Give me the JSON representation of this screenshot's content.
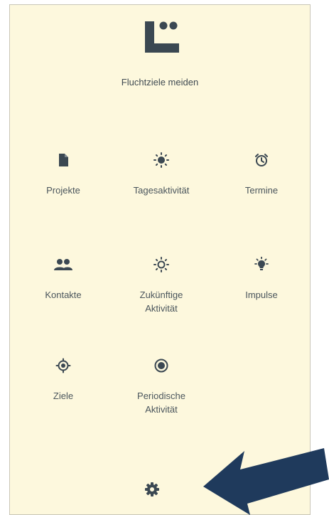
{
  "app": {
    "title": "Fluchtziele meiden"
  },
  "menu": {
    "items": [
      {
        "label": "Projekte",
        "icon": "document-icon"
      },
      {
        "label": "Tagesaktivität",
        "icon": "sun-icon"
      },
      {
        "label": "Termine",
        "icon": "alarm-clock-icon"
      },
      {
        "label": "Kontakte",
        "icon": "people-icon"
      },
      {
        "label": "Zukünftige\nAktivität",
        "icon": "sun-outline-icon"
      },
      {
        "label": "Impulse",
        "icon": "lightbulb-icon"
      },
      {
        "label": "Ziele",
        "icon": "target-icon"
      },
      {
        "label": "Periodische\nAktivität",
        "icon": "radio-target-icon"
      }
    ]
  },
  "settings": {
    "icon": "gear-icon"
  },
  "colors": {
    "background": "#fdf8dd",
    "icon": "#3b4852",
    "text": "#4a555c",
    "arrow": "#1f3a5c"
  }
}
